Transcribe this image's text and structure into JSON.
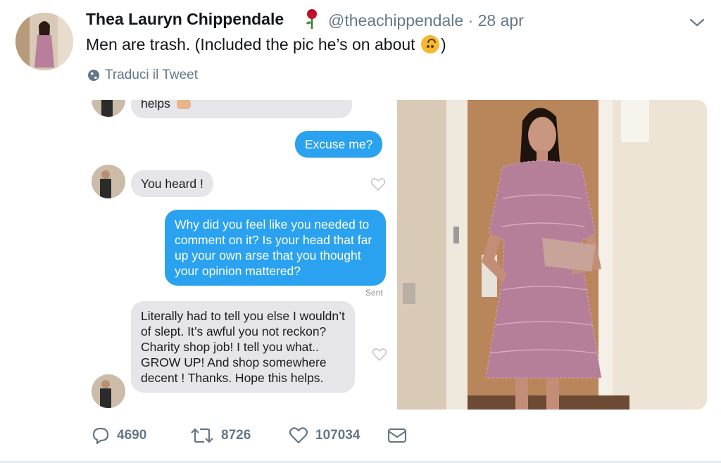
{
  "tweet": {
    "author_name": "Thea Lauryn Chippendale",
    "handle": "@theachippendale",
    "separator": "·",
    "date": "28 apr",
    "text_before": "Men are trash. (Included the pic he’s on about",
    "text_after": ")",
    "translate_label": "Traduci il Tweet"
  },
  "chat": {
    "top_partial": "helps",
    "messages": [
      {
        "from": "me",
        "text": "Excuse me?"
      },
      {
        "from": "them",
        "text": "You heard !"
      },
      {
        "from": "me",
        "text": "Why did you feel like you needed to comment on it? Is your head that far up your own arse that you thought your opinion mattered?"
      },
      {
        "from": "them",
        "text": "Literally had to tell you else I wouldn’t of slept. It’s awful you not reckon? Charity shop job! I tell you what.. GROW UP! And shop somewhere decent ! Thanks. Hope this helps."
      }
    ],
    "sent_label": "Sent"
  },
  "actions": {
    "replies": "4690",
    "retweets": "8726",
    "likes": "107034"
  },
  "colors": {
    "handle_grey": "#657786",
    "bubble_blue": "#2aa2f0",
    "bubble_grey": "#e5e5ea",
    "rose_red": "#c8102e"
  }
}
